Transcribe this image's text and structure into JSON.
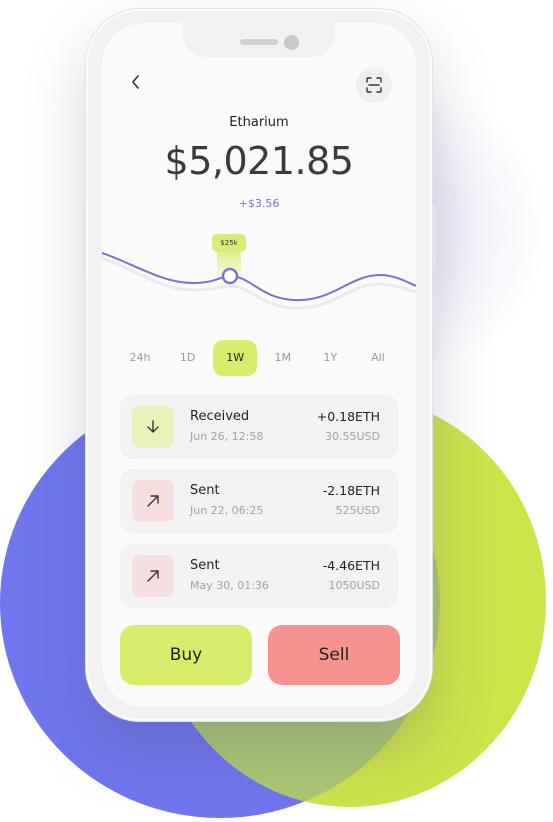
{
  "header": {
    "back_icon": "chevron-left-icon",
    "scan_icon": "scan-icon",
    "coin_name": "Etharium",
    "balance": "$5,021.85",
    "change": "+$3.56"
  },
  "chart": {
    "tooltip": "$25k",
    "line_color": "#7d6fd0",
    "highlight_color": "#d9ec78"
  },
  "ranges": {
    "items": [
      "24h",
      "1D",
      "1W",
      "1M",
      "1Y",
      "All"
    ],
    "selected": "1W"
  },
  "transactions": [
    {
      "type": "Received",
      "date": "Jun 26, 12:58",
      "amount": "+0.18ETH",
      "usd": "30.55USD",
      "icon": "arrow-down-icon"
    },
    {
      "type": "Sent",
      "date": "Jun 22, 06:25",
      "amount": "-2.18ETH",
      "usd": "525USD",
      "icon": "arrow-up-right-icon"
    },
    {
      "type": "Sent",
      "date": "May 30, 01:36",
      "amount": "-4.46ETH",
      "usd": "1050USD",
      "icon": "arrow-up-right-icon"
    }
  ],
  "actions": {
    "buy_label": "Buy",
    "sell_label": "Sell"
  },
  "colors": {
    "accent_green": "#d9ec6b",
    "accent_red": "#f4938f",
    "blob_blue": "#6f76ee",
    "blob_green": "#cde34a"
  }
}
